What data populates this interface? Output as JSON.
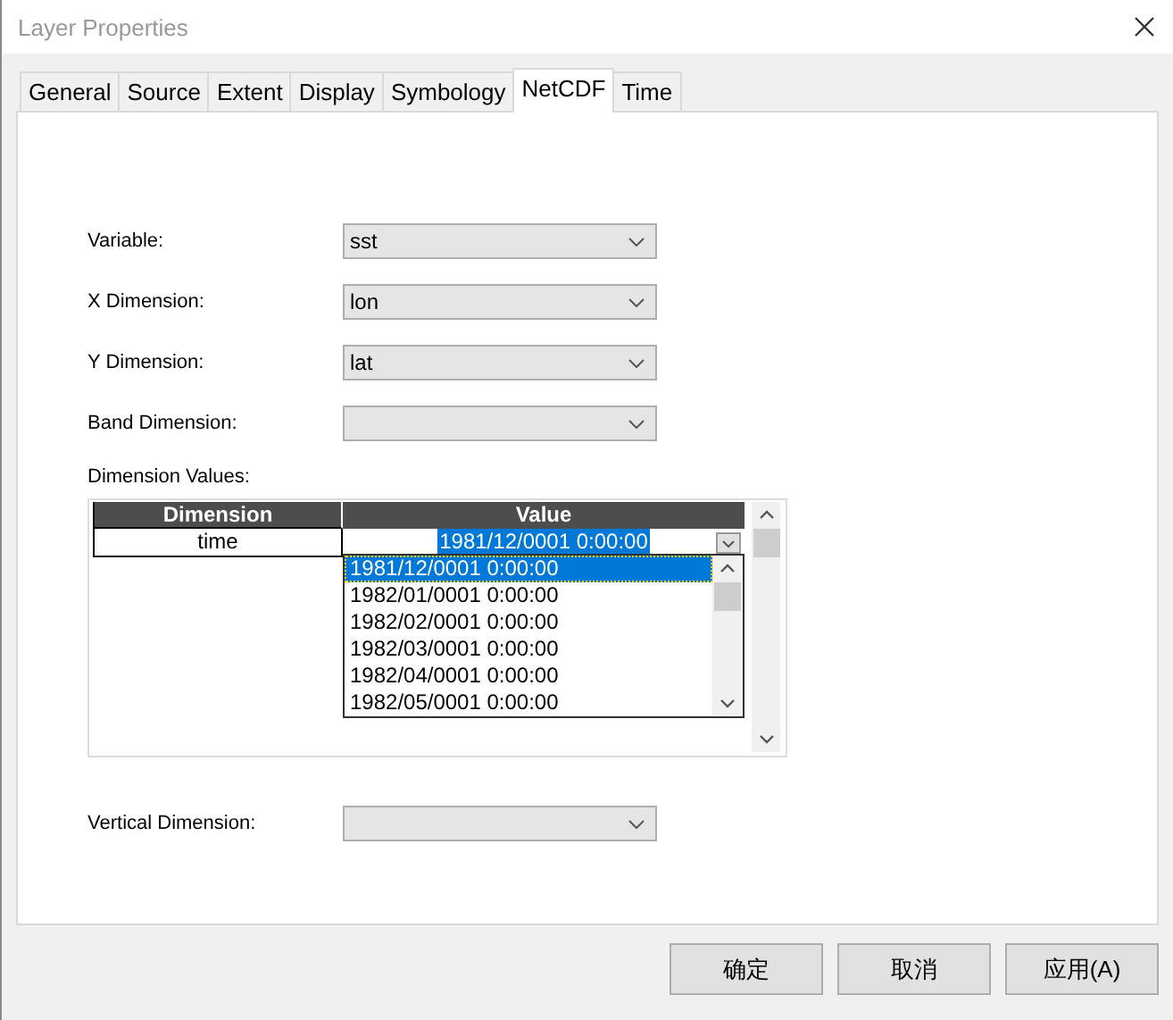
{
  "window": {
    "title": "Layer Properties"
  },
  "tabs": [
    {
      "label": "General",
      "selected": false
    },
    {
      "label": "Source",
      "selected": false
    },
    {
      "label": "Extent",
      "selected": false
    },
    {
      "label": "Display",
      "selected": false
    },
    {
      "label": "Symbology",
      "selected": false
    },
    {
      "label": "NetCDF",
      "selected": true
    },
    {
      "label": "Time",
      "selected": false
    }
  ],
  "fields": [
    {
      "label": "Variable:",
      "value": "sst"
    },
    {
      "label": "X Dimension:",
      "value": "lon"
    },
    {
      "label": "Y Dimension:",
      "value": "lat"
    },
    {
      "label": "Band Dimension:"
    }
  ],
  "dimension_values": {
    "label": "Dimension Values:",
    "columns": [
      "Dimension",
      "Value"
    ],
    "rows": [
      {
        "dimension": "time",
        "value": "1981/12/0001 0:00:00"
      }
    ],
    "dropdown_options": [
      {
        "label": "1981/12/0001 0:00:00",
        "selected": true
      },
      {
        "label": "1982/01/0001 0:00:00",
        "selected": false
      },
      {
        "label": "1982/02/0001 0:00:00",
        "selected": false
      },
      {
        "label": "1982/03/0001 0:00:00",
        "selected": false
      },
      {
        "label": "1982/04/0001 0:00:00",
        "selected": false
      },
      {
        "label": "1982/05/0001 0:00:00",
        "selected": false
      }
    ]
  },
  "vertical_dimension": {
    "label": "Vertical Dimension:"
  },
  "buttons": [
    "确定",
    "取消",
    "应用(A)"
  ]
}
